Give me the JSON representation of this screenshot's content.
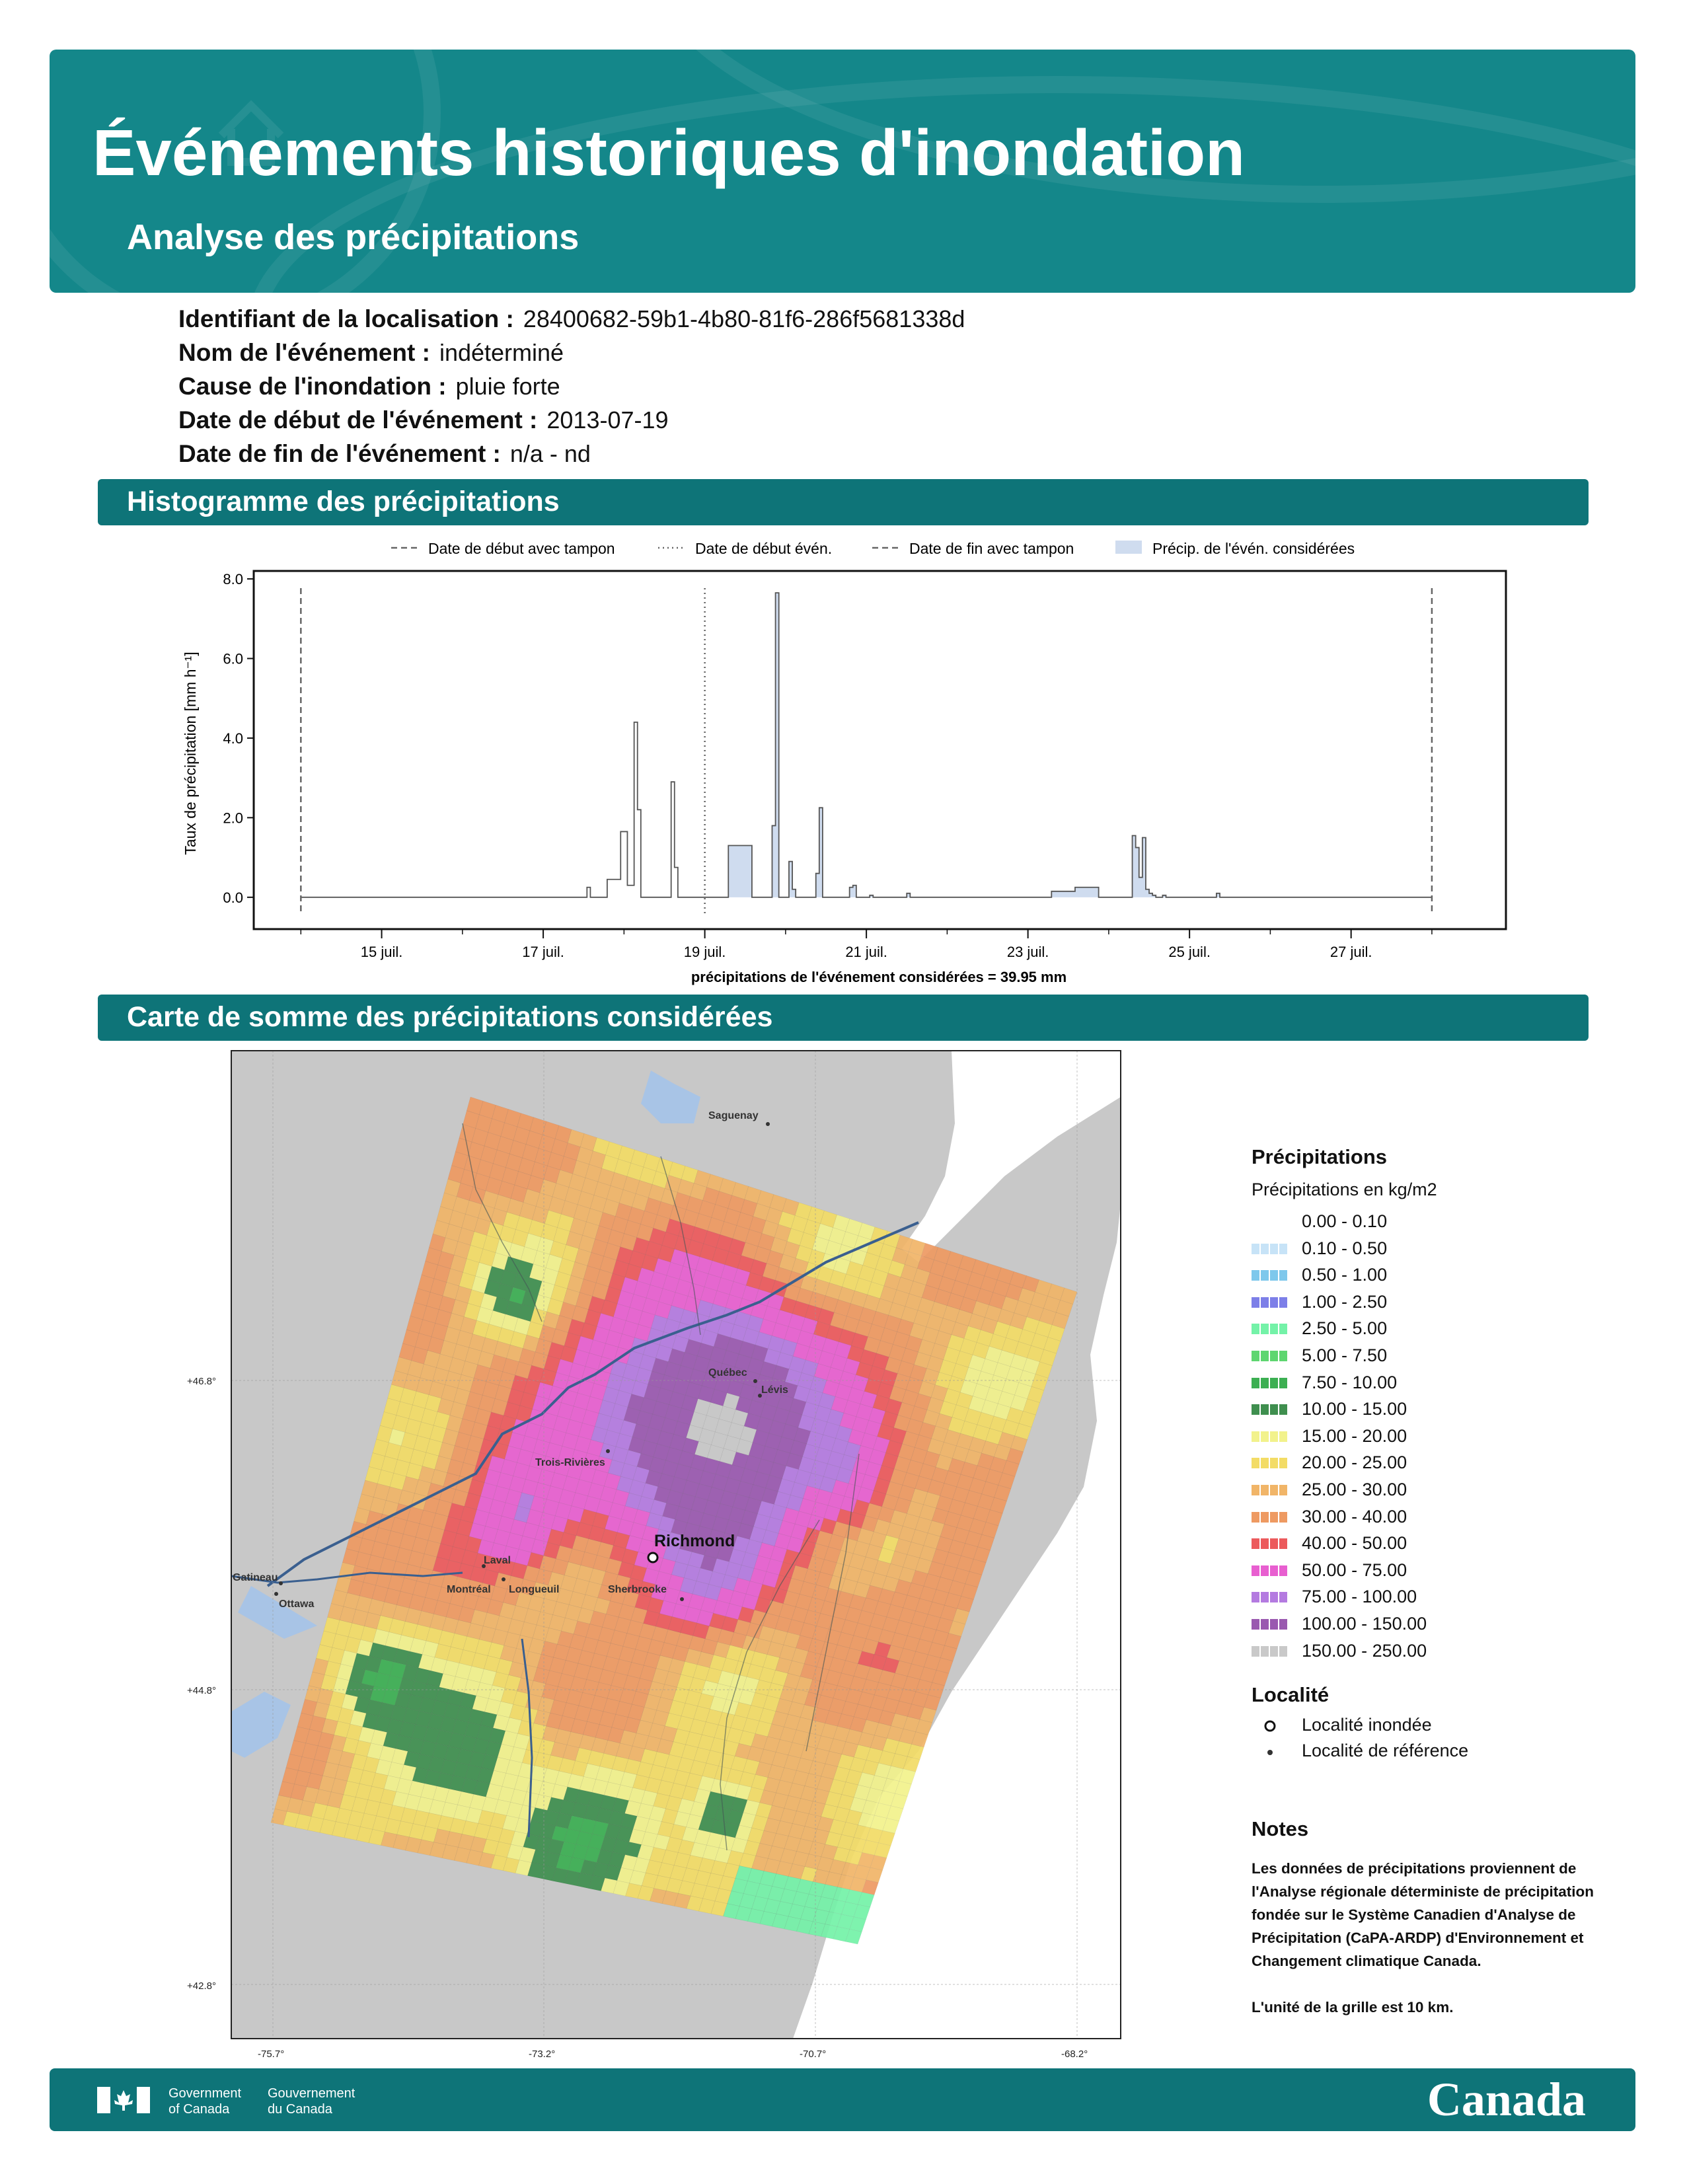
{
  "header": {
    "title": "Événements historiques d'inondation",
    "subtitle": "Analyse des précipitations"
  },
  "event_info": [
    {
      "label": "Identifiant de la localisation :",
      "value": "28400682-59b1-4b80-81f6-286f5681338d"
    },
    {
      "label": "Nom de l'événement :",
      "value": "indéterminé"
    },
    {
      "label": "Cause de l'inondation :",
      "value": "pluie forte"
    },
    {
      "label": "Date de début de l'événement :",
      "value": "2013-07-19"
    },
    {
      "label": "Date de fin de l'événement :",
      "value": "n/a - nd"
    }
  ],
  "histogram_section": {
    "title": "Histogramme des précipitations"
  },
  "map_section": {
    "title": "Carte de somme des précipitations considérées"
  },
  "chart_data": {
    "type": "line",
    "ylabel": "Taux de précipitation [mm h⁻¹]",
    "xlabel": "précipitations de l'événement considérées = 39.95 mm",
    "ylim": [
      -0.8,
      8.2
    ],
    "yticks": [
      "8.0",
      "6.0",
      "4.0",
      "2.0",
      "0.0"
    ],
    "ytick_values": [
      8,
      6,
      4,
      2,
      0
    ],
    "xlim": [
      "2013-07-13T10:00",
      "2013-07-28T22:00"
    ],
    "xtick_labels": [
      "15 juil.",
      "17 juil.",
      "19 juil.",
      "21 juil.",
      "23 juil.",
      "25 juil.",
      "27 juil."
    ],
    "xtick_dates": [
      "2013-07-15",
      "2013-07-17",
      "2013-07-19",
      "2013-07-21",
      "2013-07-23",
      "2013-07-25",
      "2013-07-27"
    ],
    "legend": [
      {
        "label": "Date de début avec tampon",
        "style": "dashed"
      },
      {
        "label": "Date de début évén.",
        "style": "dotted"
      },
      {
        "label": "Date de fin avec tampon",
        "style": "dashed"
      },
      {
        "label": "Précip. de l'évén. considérées",
        "style": "fill"
      }
    ],
    "vlines": [
      {
        "name": "Date de début avec tampon",
        "x": "2013-07-14T00:00",
        "style": "dashed"
      },
      {
        "name": "Date de début évén.",
        "x": "2013-07-19T00:00",
        "style": "dotted"
      },
      {
        "name": "Date de fin avec tampon",
        "x": "2013-07-28T00:00",
        "style": "dashed"
      }
    ],
    "series": [
      {
        "x": [
          "2013-07-14T00:00",
          "2013-07-17T12:00",
          "2013-07-17T13:00",
          "2013-07-17T14:00",
          "2013-07-17T18:00",
          "2013-07-17T19:00",
          "2013-07-17T22:00",
          "2013-07-17T23:00",
          "2013-07-18T00:00",
          "2013-07-18T01:00",
          "2013-07-18T02:00",
          "2013-07-18T03:00",
          "2013-07-18T04:00",
          "2013-07-18T05:00",
          "2013-07-18T06:00",
          "2013-07-18T13:00",
          "2013-07-18T14:00",
          "2013-07-18T15:00",
          "2013-07-18T16:00",
          "2013-07-18T17:00",
          "2013-07-19T06:00",
          "2013-07-19T07:00",
          "2013-07-19T13:00",
          "2013-07-19T14:00",
          "2013-07-19T15:00",
          "2013-07-19T16:00",
          "2013-07-19T20:00",
          "2013-07-19T21:00",
          "2013-07-19T22:00",
          "2013-07-19T23:00",
          "2013-07-20T00:00",
          "2013-07-20T01:00",
          "2013-07-20T02:00",
          "2013-07-20T03:00",
          "2013-07-20T04:00",
          "2013-07-20T05:00",
          "2013-07-20T09:00",
          "2013-07-20T10:00",
          "2013-07-20T11:00",
          "2013-07-20T12:00",
          "2013-07-20T18:00",
          "2013-07-20T19:00",
          "2013-07-20T20:00",
          "2013-07-20T21:00",
          "2013-07-20T22:00",
          "2013-07-21T00:00",
          "2013-07-21T01:00",
          "2013-07-21T02:00",
          "2013-07-21T03:00",
          "2013-07-21T04:00",
          "2013-07-21T12:00",
          "2013-07-21T13:00",
          "2013-07-23T06:00",
          "2013-07-23T07:00",
          "2013-07-23T13:00",
          "2013-07-23T14:00",
          "2013-07-23T20:00",
          "2013-07-23T21:00",
          "2013-07-24T06:00",
          "2013-07-24T07:00",
          "2013-07-24T08:00",
          "2013-07-24T09:00",
          "2013-07-24T10:00",
          "2013-07-24T11:00",
          "2013-07-24T12:00",
          "2013-07-24T13:00",
          "2013-07-24T14:00",
          "2013-07-24T16:00",
          "2013-07-24T17:00",
          "2013-07-25T07:00",
          "2013-07-25T08:00",
          "2013-07-25T09:00",
          "2013-07-28T00:00"
        ],
        "y": [
          0,
          0,
          0.25,
          0,
          0,
          0.45,
          0.45,
          1.65,
          1.65,
          0.3,
          0.3,
          4.4,
          2.2,
          0,
          0,
          0,
          2.9,
          0.75,
          0,
          0,
          0,
          1.3,
          1.3,
          0,
          0,
          0,
          1.8,
          7.65,
          0,
          0,
          0,
          0.9,
          0.2,
          0,
          0,
          0,
          0.6,
          2.25,
          0,
          0,
          0,
          0.25,
          0.3,
          0,
          0,
          0,
          0.05,
          0,
          0,
          0,
          0.1,
          0,
          0,
          0.15,
          0.15,
          0.25,
          0.25,
          0,
          0,
          1.55,
          1.25,
          0.5,
          1.5,
          0.2,
          0.1,
          0.05,
          0,
          0.05,
          0,
          0,
          0.1,
          0,
          0
        ]
      }
    ],
    "event_fill_range": [
      "2013-07-19T00:00",
      "2013-07-28T00:00"
    ]
  },
  "map": {
    "localities": [
      "Saguenay",
      "Québec",
      "Lévis",
      "Trois-Rivières",
      "Richmond",
      "Laval",
      "Gatineau",
      "Montréal",
      "Longueuil",
      "Ottawa",
      "Sherbrooke"
    ],
    "lat_labels": [
      "+46.8°",
      "+44.8°",
      "+42.8°"
    ],
    "lon_labels": [
      "-75.7°",
      "-73.2°",
      "-70.7°",
      "-68.2°"
    ],
    "colors": {
      "land": "#c8c8c8",
      "water": "#a8c4e6",
      "river": "#3a5f8f"
    }
  },
  "legend": {
    "title": "Précipitations",
    "subtitle": "Précipitations en kg/m2",
    "classes": [
      {
        "label": "0.00 - 0.10",
        "color": "#ffffff"
      },
      {
        "label": "0.10 - 0.50",
        "color": "#c7e3f7"
      },
      {
        "label": "0.50 - 1.00",
        "color": "#7ec8ec"
      },
      {
        "label": "1.00 - 2.50",
        "color": "#7d7fe8"
      },
      {
        "label": "2.50 - 5.00",
        "color": "#74f2a8"
      },
      {
        "label": "5.00 - 7.50",
        "color": "#5ed670"
      },
      {
        "label": "7.50 - 10.00",
        "color": "#3caf52"
      },
      {
        "label": "10.00 - 15.00",
        "color": "#3f8f4f"
      },
      {
        "label": "15.00 - 20.00",
        "color": "#f2f28c"
      },
      {
        "label": "20.00 - 25.00",
        "color": "#f3dc66"
      },
      {
        "label": "25.00 - 30.00",
        "color": "#f1b568"
      },
      {
        "label": "30.00 - 40.00",
        "color": "#ee9a62"
      },
      {
        "label": "40.00 - 50.00",
        "color": "#ec5a5c"
      },
      {
        "label": "50.00 - 75.00",
        "color": "#e85fd0"
      },
      {
        "label": "75.00 - 100.00",
        "color": "#b47ae0"
      },
      {
        "label": "100.00 - 150.00",
        "color": "#9a59b0"
      },
      {
        "label": "150.00 - 250.00",
        "color": "#c9c9c9"
      }
    ],
    "locality_title": "Localité",
    "locality_items": [
      {
        "label": "Localité inondée",
        "marker": "open-circle"
      },
      {
        "label": "Localité de référence",
        "marker": "dot"
      }
    ]
  },
  "notes": {
    "title": "Notes",
    "text1": "Les données de précipitations proviennent de l'Analyse régionale déterministe de précipitation fondée sur le Système Canadien d'Analyse de Précipitation (CaPA-ARDP) d'Environnement et Changement climatique Canada.",
    "text2": "L'unité de la grille est 10 km."
  },
  "footer": {
    "gov_en": "Government\nof Canada",
    "gov_fr": "Gouvernement\ndu Canada",
    "wordmark": "Canada"
  }
}
